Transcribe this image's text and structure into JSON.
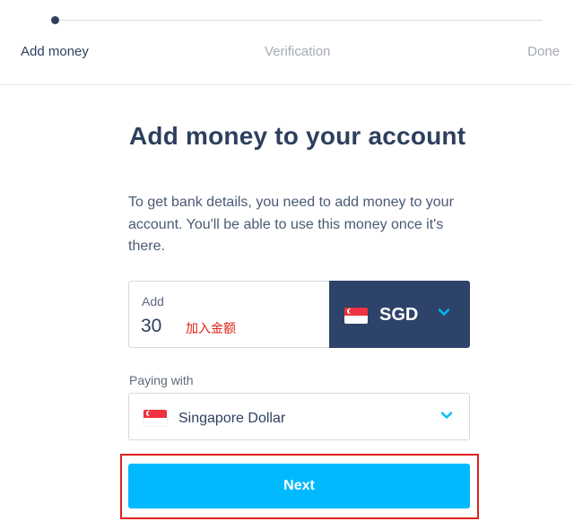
{
  "stepper": {
    "steps": [
      {
        "label": "Add money",
        "state": "active"
      },
      {
        "label": "Verification",
        "state": "upcoming"
      },
      {
        "label": "Done",
        "state": "upcoming"
      }
    ]
  },
  "main": {
    "title": "Add money to your account",
    "description": "To get bank details, you need to add money to your account. You'll be able to use this money once it's there."
  },
  "amount": {
    "label": "Add",
    "value": "30",
    "annotation": "加入金额"
  },
  "currency": {
    "code": "SGD",
    "flag_icon": "singapore-flag-icon"
  },
  "paying_with": {
    "label": "Paying with",
    "value": "Singapore Dollar",
    "flag_icon": "singapore-flag-icon"
  },
  "actions": {
    "next_label": "Next"
  },
  "colors": {
    "navy": "#2e4369",
    "text": "#2e3f5e",
    "accent": "#00b9ff",
    "annotation_red": "#e0201a"
  }
}
